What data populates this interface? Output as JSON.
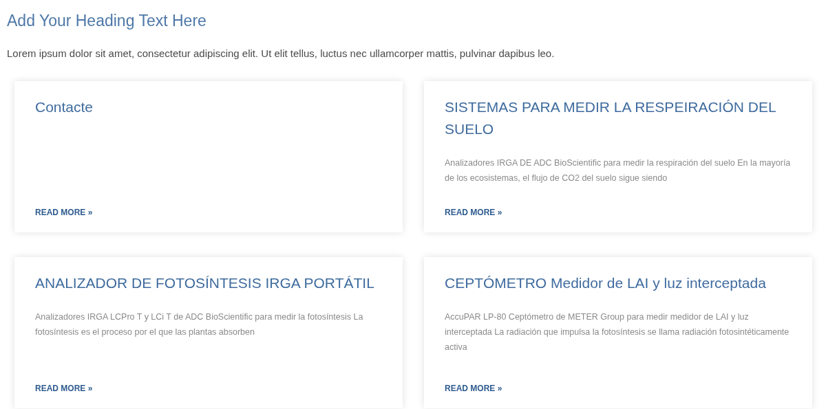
{
  "heading": "Add Your Heading Text Here",
  "intro": "Lorem ipsum dolor sit amet, consectetur adipiscing elit. Ut elit tellus, luctus nec ullamcorper mattis, pulvinar dapibus leo.",
  "cards": [
    {
      "title": "Contacte",
      "link": "READ MORE »"
    },
    {
      "title": "SISTEMAS PARA MEDIR LA RESPEIRACIÓN DEL SUELO",
      "excerpt": "Analizadores IRGA DE ADC BioScientific para medir la respiración del suelo En la mayoría de los ecosistemas, el flujo de CO2 del suelo sigue siendo",
      "link": "READ MORE »"
    },
    {
      "title": "ANALIZADOR DE FOTOSÍNTESIS IRGA PORTÁTIL",
      "excerpt": "Analizadores IRGA LCPro T y LCi T de ADC BioScientific para medir la fotosíntesis La fotosíntesis es el proceso por el que las plantas absorben",
      "link": "READ MORE »"
    },
    {
      "title": "CEPTÓMETRO Medidor de LAI y luz interceptada",
      "excerpt": "AccuPAR LP-80 Ceptómetro de METER Group para medir medidor de LAI y luz interceptada La radiación que impulsa la fotosíntesis se llama radiación fotosintéticamente activa",
      "link": "READ MORE »"
    }
  ]
}
